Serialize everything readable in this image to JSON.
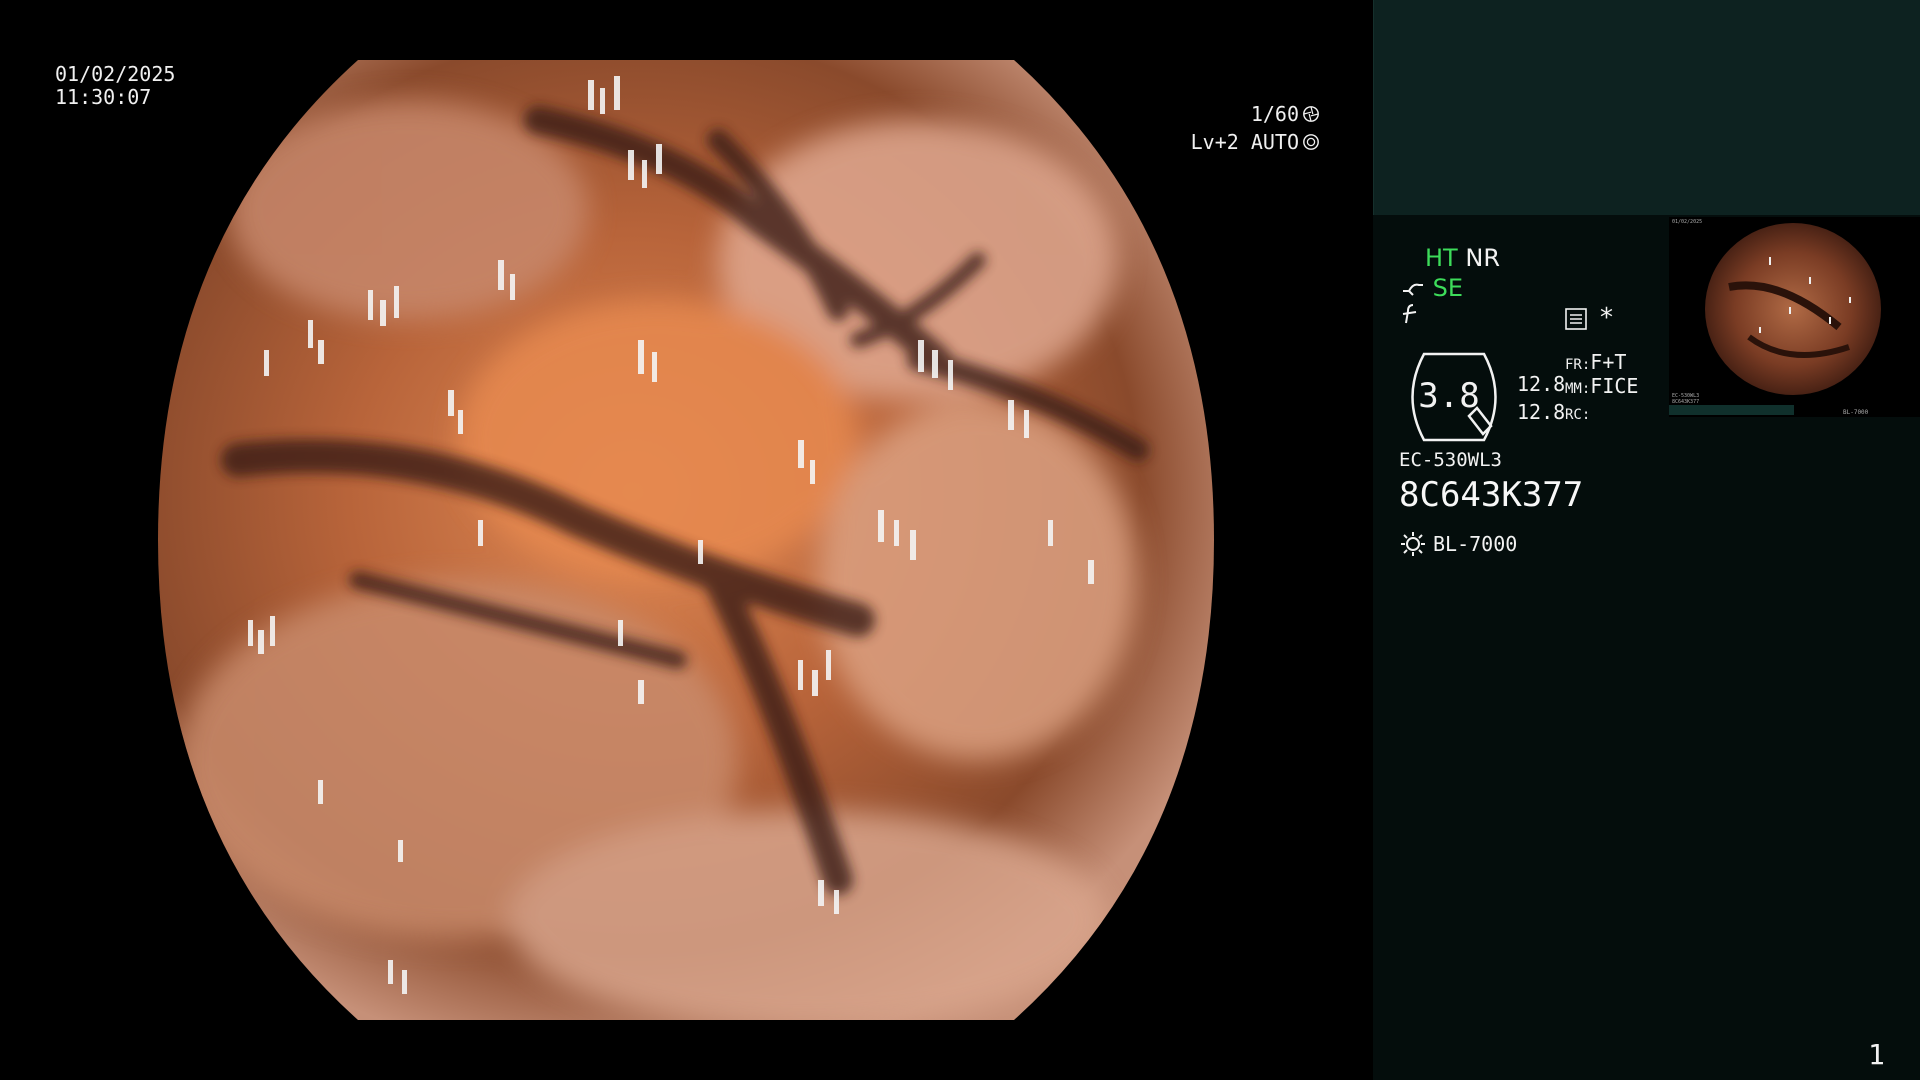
{
  "overlay": {
    "date": "01/02/2025",
    "time": "11:30:07",
    "shutter": "1/60",
    "iris": "Lv+2 AUTO"
  },
  "panel": {
    "modes": {
      "ht": "HT",
      "nr": "NR",
      "se": "SE"
    },
    "star": "*",
    "zoom": "3.8",
    "values": [
      "12.8",
      "12.8"
    ],
    "fr": {
      "key": "FR:",
      "value": "F+T"
    },
    "mm": {
      "key": "MM:",
      "value": "FICE"
    },
    "rc": {
      "key": "RC:",
      "value": ""
    },
    "scope_model": "EC-530WL3",
    "serial": "8C643K377",
    "light_source": "BL-7000",
    "page_number": "1"
  },
  "thumbnail": {
    "date_small": "01/02/2025",
    "model_small": "EC-530WL3",
    "serial_small": "8C643K377",
    "light_small": "BL-7000"
  },
  "colors": {
    "mode_green": "#3ddc5a",
    "panel_top": "#0d2220",
    "panel_bg": "#040d0c"
  },
  "icons": [
    "shutter-icon",
    "iris-icon",
    "scope-bend-icon",
    "filter-f-icon",
    "menu-list-icon",
    "lamp-icon"
  ]
}
